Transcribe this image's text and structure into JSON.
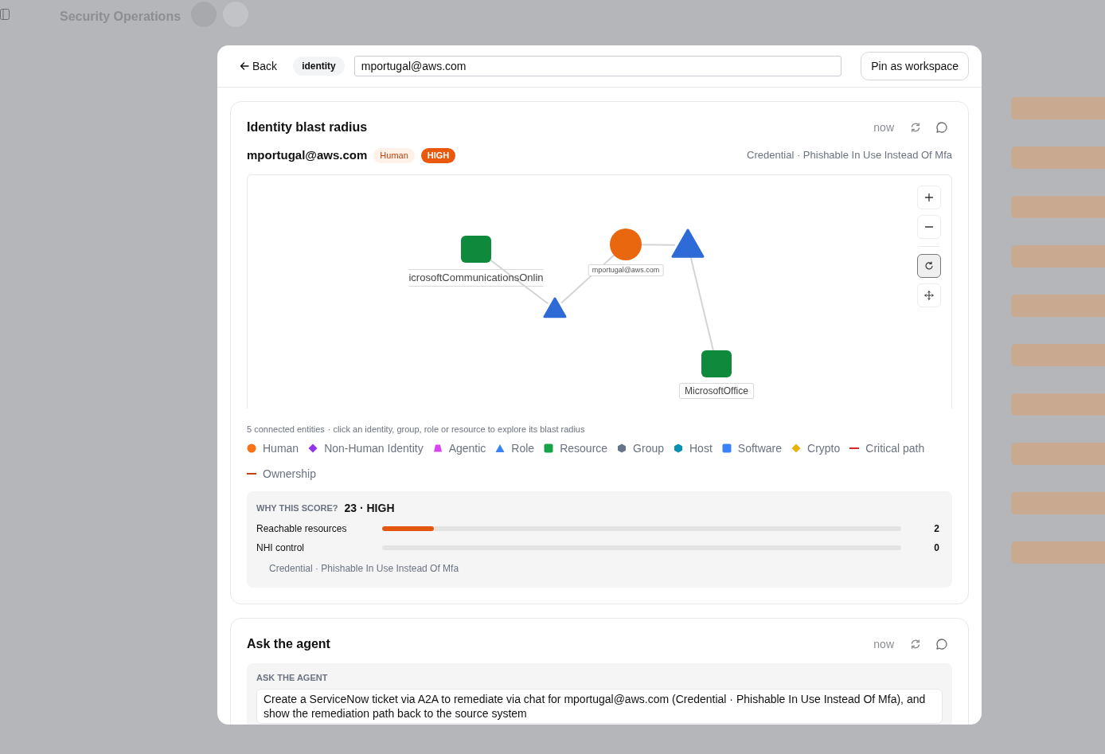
{
  "background": {
    "title": "Security Operations"
  },
  "dialog": {
    "back": "Back",
    "scope": "identity",
    "query": "mportugal@aws.com",
    "pin": "Pin as workspace"
  },
  "blast_card": {
    "title": "Identity blast radius",
    "time": "now",
    "identity": "mportugal@aws.com",
    "badges": [
      {
        "text": "Human",
        "kind": "type"
      },
      {
        "text": "HIGH",
        "kind": "severity"
      }
    ],
    "finding": "Credential · Phishable In Use Instead Of Mfa",
    "graph": {
      "nodes": [
        {
          "kind": "resource",
          "label": "icrosoftCommunicationsOnlin",
          "connected_to_next": true
        },
        {
          "kind": "role",
          "connected_to_next": true
        },
        {
          "kind": "human",
          "label": "mportugal@aws.com",
          "connected_to_next": true
        },
        {
          "kind": "role",
          "connected_to_next": true
        },
        {
          "kind": "resource",
          "label": "MicrosoftOffice",
          "connected_to_next": false
        }
      ],
      "controls": [
        {
          "kind": "zoom_in",
          "pressed": false
        },
        {
          "kind": "zoom_out",
          "pressed": false
        },
        {
          "kind": "reset",
          "pressed": true
        },
        {
          "kind": "pan",
          "pressed": false
        }
      ]
    },
    "caption": [
      "5 connected entities",
      "· click an identity, group, role or resource to explore its blast radius"
    ],
    "legend": [
      {
        "kind": "circle",
        "label": "Human",
        "color": "#f97316"
      },
      {
        "kind": "diamond",
        "label": "Non-Human Identity",
        "color": "#9333ea"
      },
      {
        "kind": "trapezoid",
        "label": "Agentic",
        "color": "#d946ef"
      },
      {
        "kind": "triangle",
        "label": "Role",
        "color": "#3b82f6"
      },
      {
        "kind": "square",
        "label": "Resource",
        "color": "#16a34a"
      },
      {
        "kind": "hexagon",
        "label": "Group",
        "color": "#64748b"
      },
      {
        "kind": "hexagon",
        "label": "Host",
        "color": "#0891b2"
      },
      {
        "kind": "square",
        "label": "Software",
        "color": "#3b82f6"
      },
      {
        "kind": "diamond",
        "label": "Crypto",
        "color": "#eab308"
      },
      {
        "kind": "line",
        "label": "Critical path",
        "color": "#dc2626"
      },
      {
        "kind": "line",
        "label": "Ownership",
        "color": "#c2410c"
      }
    ],
    "score": {
      "label": "WHY THIS SCORE?",
      "value": "23 · HIGH",
      "factors": [
        {
          "label": "Reachable resources",
          "level": 0.1,
          "value": "2"
        },
        {
          "label": "NHI control",
          "level": 0,
          "value": "0"
        }
      ],
      "note": "Credential · Phishable In Use Instead Of Mfa"
    }
  },
  "agent_card": {
    "title": "Ask the agent",
    "time": "now",
    "section": "ASK THE AGENT",
    "prompt": "Create a ServiceNow ticket via A2A to remediate via chat for mportugal@aws.com (Credential · Phishable In Use Instead Of Mfa), and show the remediation path back to the source system"
  }
}
